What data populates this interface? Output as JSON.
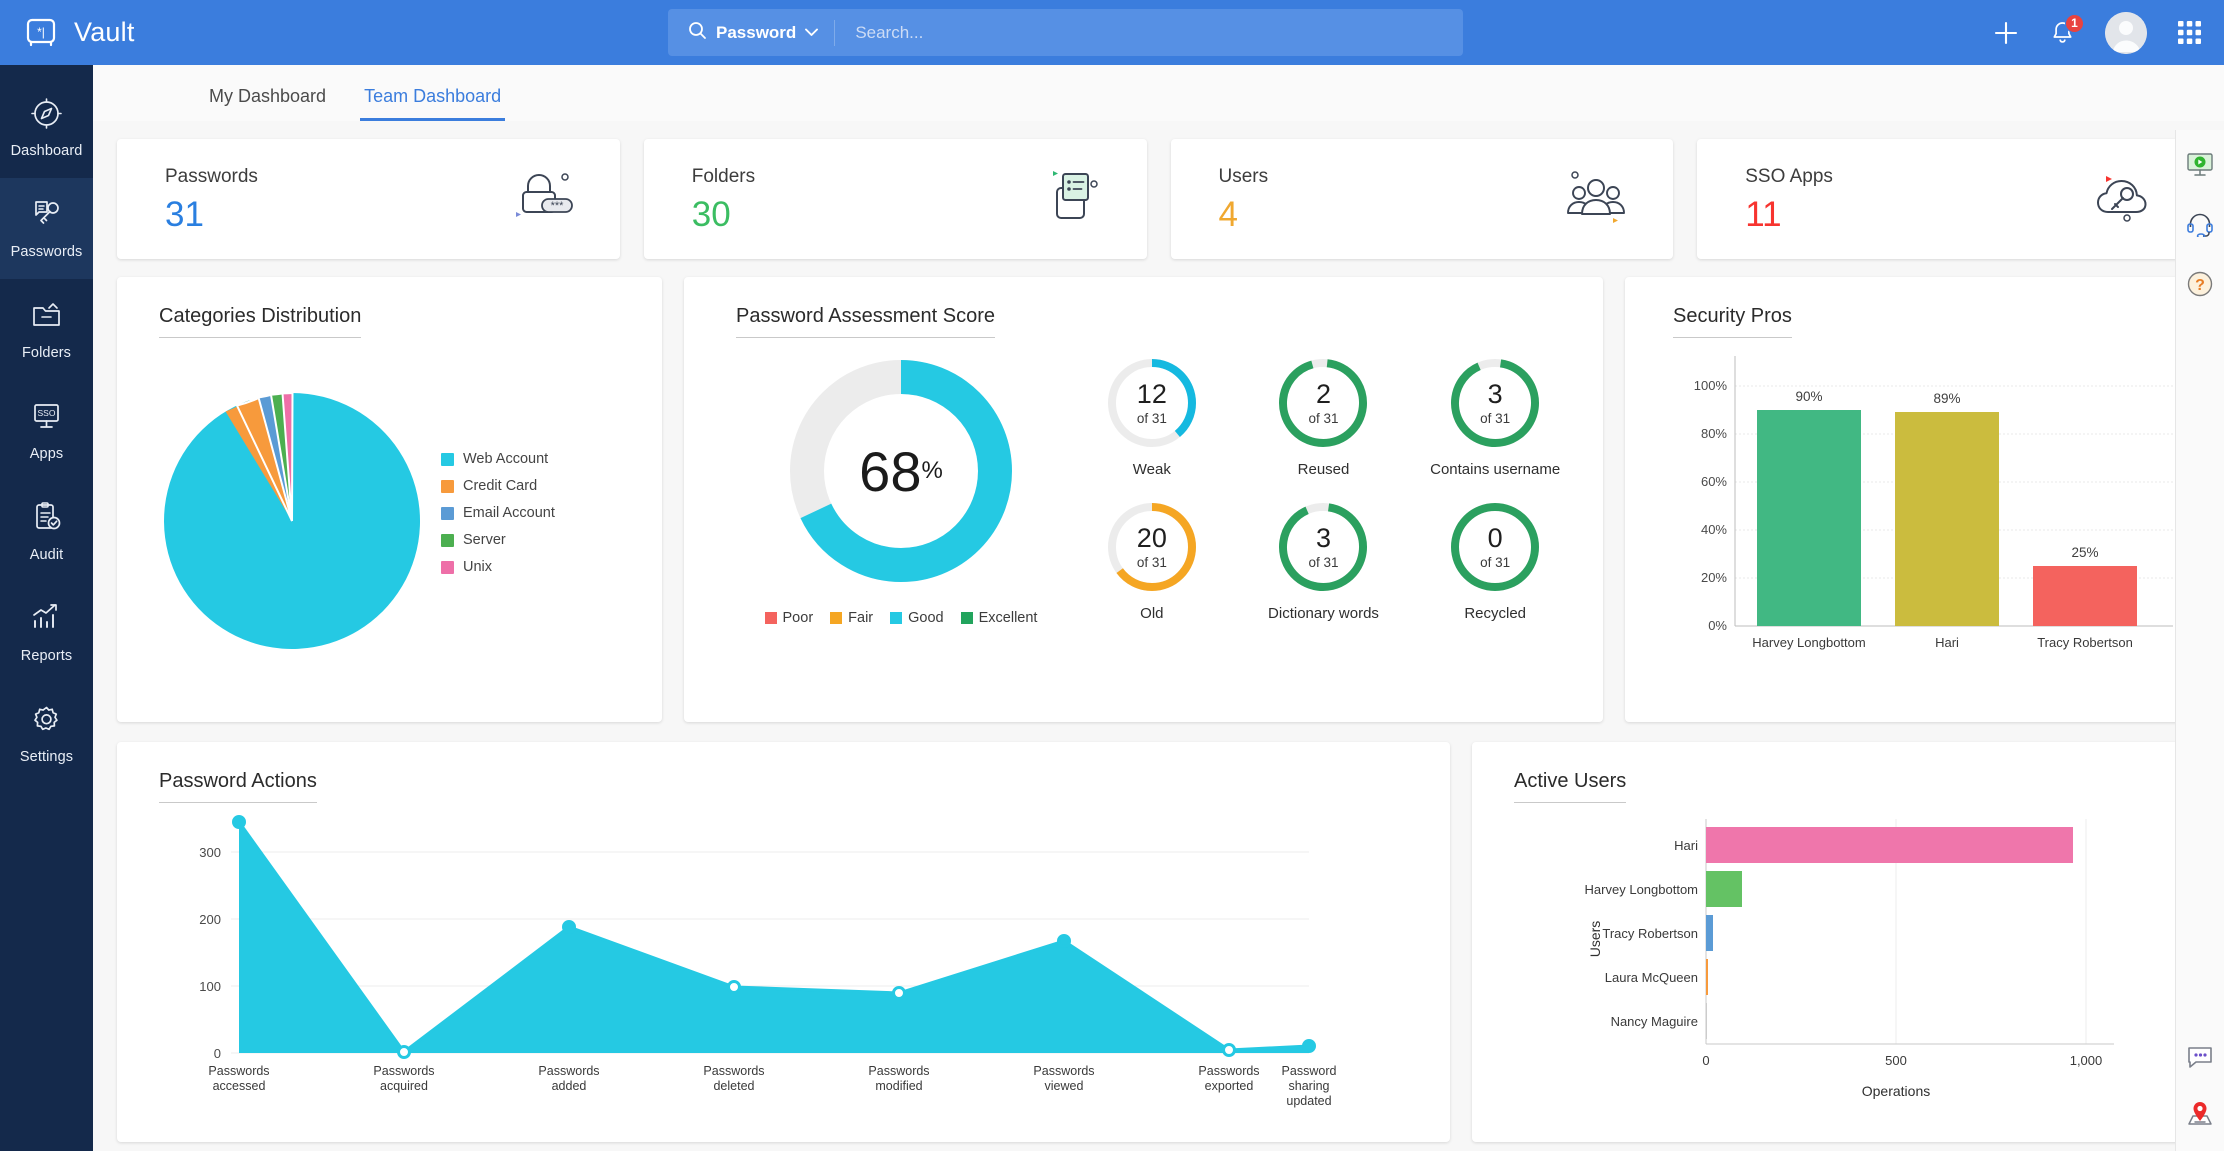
{
  "app": {
    "brand": "Vault",
    "logo_icon": "vault-logo-icon"
  },
  "search": {
    "category": "Password",
    "placeholder": "Search...",
    "value": "",
    "search_icon": "search-icon",
    "chevron_icon": "chevron-down-icon"
  },
  "topbar_actions": {
    "add_icon": "plus-icon",
    "notifications_icon": "bell-icon",
    "notifications_count": "1",
    "avatar_icon": "user-avatar-icon",
    "apps_grid_icon": "grid-apps-icon"
  },
  "sidebar": {
    "items": [
      {
        "label": "Dashboard",
        "icon": "compass-icon",
        "active": false
      },
      {
        "label": "Passwords",
        "icon": "key-document-icon",
        "active": true
      },
      {
        "label": "Folders",
        "icon": "folder-icon",
        "active": false
      },
      {
        "label": "Apps",
        "icon": "sso-monitor-icon",
        "active": false
      },
      {
        "label": "Audit",
        "icon": "clipboard-check-icon",
        "active": false
      },
      {
        "label": "Reports",
        "icon": "bar-chart-arrow-icon",
        "active": false
      },
      {
        "label": "Settings",
        "icon": "gear-icon",
        "active": false
      }
    ]
  },
  "tabs": [
    {
      "label": "My Dashboard",
      "active": false
    },
    {
      "label": "Team Dashboard",
      "active": true
    }
  ],
  "stats": [
    {
      "label": "Passwords",
      "value": "31",
      "color": "#2a7fe0",
      "icon": "padlock-asterisks-icon"
    },
    {
      "label": "Folders",
      "value": "30",
      "color": "#3bbd62",
      "icon": "folder-list-icon"
    },
    {
      "label": "Users",
      "value": "4",
      "color": "#f0a830",
      "icon": "users-group-icon"
    },
    {
      "label": "SSO Apps",
      "value": "11",
      "color": "#f7342f",
      "icon": "cloud-key-icon"
    }
  ],
  "cards": {
    "categories_title": "Categories Distribution",
    "assessment_title": "Password Assessment Score",
    "security_pros_title": "Security Pros",
    "password_actions_title": "Password Actions",
    "active_users_title": "Active Users"
  },
  "chart_data": [
    {
      "type": "pie",
      "title": "Categories Distribution",
      "categories": [
        "Web Account",
        "Credit Card",
        "Email Account",
        "Server",
        "Unix"
      ],
      "values": [
        87,
        4,
        3.5,
        3,
        2.5
      ],
      "colors": [
        "#25c9e3",
        "#f79a3c",
        "#5b9bd5",
        "#4caf50",
        "#ee6fa8"
      ],
      "legend_position": "right"
    },
    {
      "type": "pie",
      "title": "Password Assessment Score",
      "subtitle": "donut",
      "center_value": "68",
      "center_symbol": "%",
      "values": [
        68,
        32
      ],
      "colors": [
        "#25c9e3",
        "#ececec"
      ],
      "legend": [
        {
          "label": "Poor",
          "color": "#f4635e"
        },
        {
          "label": "Fair",
          "color": "#f5a623"
        },
        {
          "label": "Good",
          "color": "#25c9e3"
        },
        {
          "label": "Excellent",
          "color": "#22a45d"
        }
      ],
      "legend_position": "bottom"
    },
    {
      "type": "bar",
      "title": "Security Pros",
      "categories": [
        "Harvey Longbottom",
        "Hari",
        "Tracy Robertson"
      ],
      "values": [
        90,
        89,
        25
      ],
      "data_labels": [
        "90%",
        "89%",
        "25%"
      ],
      "colors": [
        "#41b883",
        "#cbbc3e",
        "#f4635e"
      ],
      "ylim": [
        0,
        100
      ],
      "yticks": [
        "0%",
        "20%",
        "40%",
        "60%",
        "80%",
        "100%"
      ],
      "xlabel": "",
      "ylabel": "",
      "grid": true
    },
    {
      "type": "area",
      "title": "Password Actions",
      "categories": [
        "Passwords\naccessed",
        "Passwords\nacquired",
        "Passwords\nadded",
        "Passwords\ndeleted",
        "Passwords\nmodified",
        "Passwords\nviewed",
        "Passwords\nexported",
        "Password\nsharing\nupdated"
      ],
      "values": [
        345,
        2,
        188,
        98,
        90,
        168,
        5,
        10
      ],
      "color": "#25c9e3",
      "ylim": [
        0,
        360
      ],
      "yticks": [
        "0",
        "100",
        "200",
        "300"
      ],
      "xlabel": "",
      "ylabel": "",
      "grid": true
    },
    {
      "type": "bar",
      "orientation": "horizontal",
      "title": "Active Users",
      "categories": [
        "Hari",
        "Harvey Longbottom",
        "Tracy Robertson",
        "Laura McQueen",
        "Nancy Maguire"
      ],
      "values": [
        965,
        95,
        18,
        3,
        0
      ],
      "colors": [
        "#ef76ab",
        "#64c264",
        "#5b9bd5",
        "#f79a3c",
        "#cccccc"
      ],
      "xlim": [
        0,
        1000
      ],
      "xticks": [
        "0",
        "500",
        "1,000"
      ],
      "xlabel": "Operations",
      "ylabel": "Users",
      "grid": true
    }
  ],
  "assessment_rings": [
    {
      "value": "12",
      "of": "of 31",
      "label": "Weak",
      "pct": 39,
      "color": "#15b9e0"
    },
    {
      "value": "2",
      "of": "of 31",
      "label": "Reused",
      "pct": 94,
      "color": "#2ba05f"
    },
    {
      "value": "3",
      "of": "of 31",
      "label": "Contains username",
      "pct": 91,
      "color": "#2ba05f"
    },
    {
      "value": "20",
      "of": "of 31",
      "label": "Old",
      "pct": 65,
      "color": "#f5a623"
    },
    {
      "value": "3",
      "of": "of 31",
      "label": "Dictionary words",
      "pct": 91,
      "color": "#2ba05f"
    },
    {
      "value": "0",
      "of": "of 31",
      "label": "Recycled",
      "pct": 100,
      "color": "#2ba05f"
    }
  ],
  "rail": {
    "top": [
      {
        "icon": "video-monitor-icon"
      },
      {
        "icon": "headset-support-icon"
      },
      {
        "icon": "help-question-icon"
      }
    ],
    "bottom": [
      {
        "icon": "chat-bubble-icon"
      },
      {
        "icon": "location-pin-icon"
      }
    ]
  }
}
